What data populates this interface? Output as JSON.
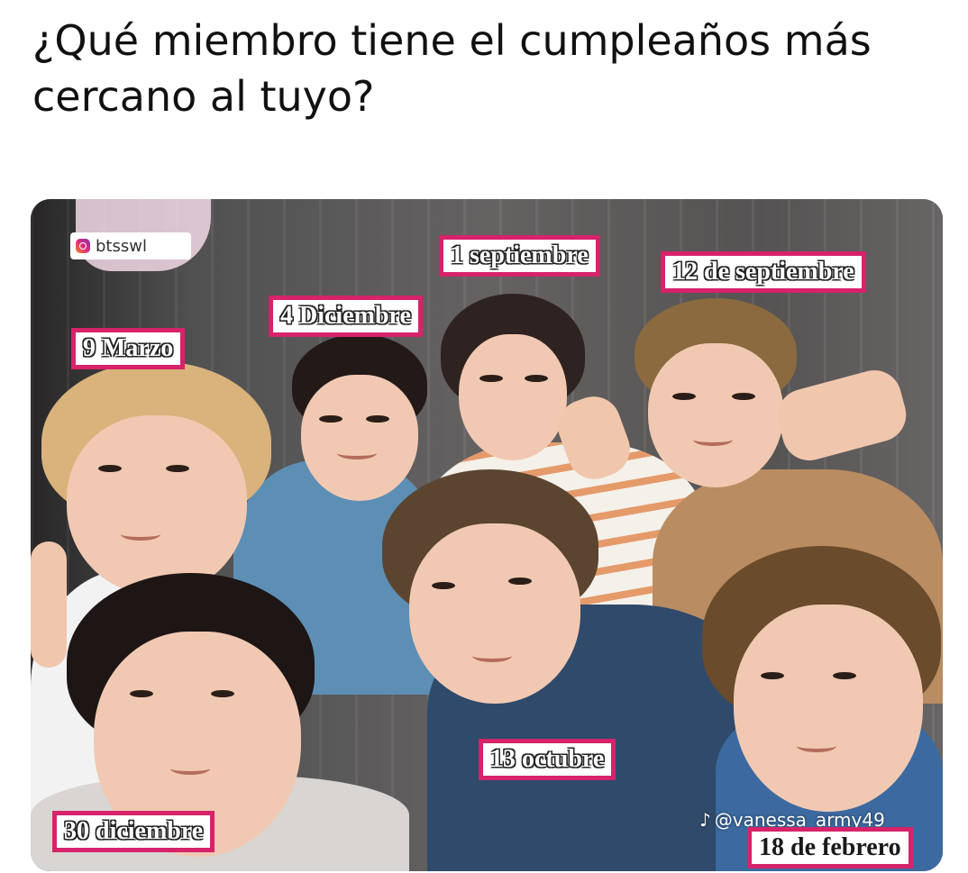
{
  "post": {
    "text": "¿Qué miembro tiene el cumpleaños más cercano al tuyo?"
  },
  "photo": {
    "watermark_handle": "btsswl",
    "tiktok_handle": "@vanessa_army49",
    "labels": {
      "jungkook": "1 septiembre",
      "rm": "12 de septiembre",
      "jin": "4 Diciembre",
      "suga": "9 Marzo",
      "jimin": "13 octubre",
      "v": "30 diciembre",
      "jhope": "18 de febrero"
    }
  },
  "colors": {
    "label_border": "#d6236a"
  }
}
